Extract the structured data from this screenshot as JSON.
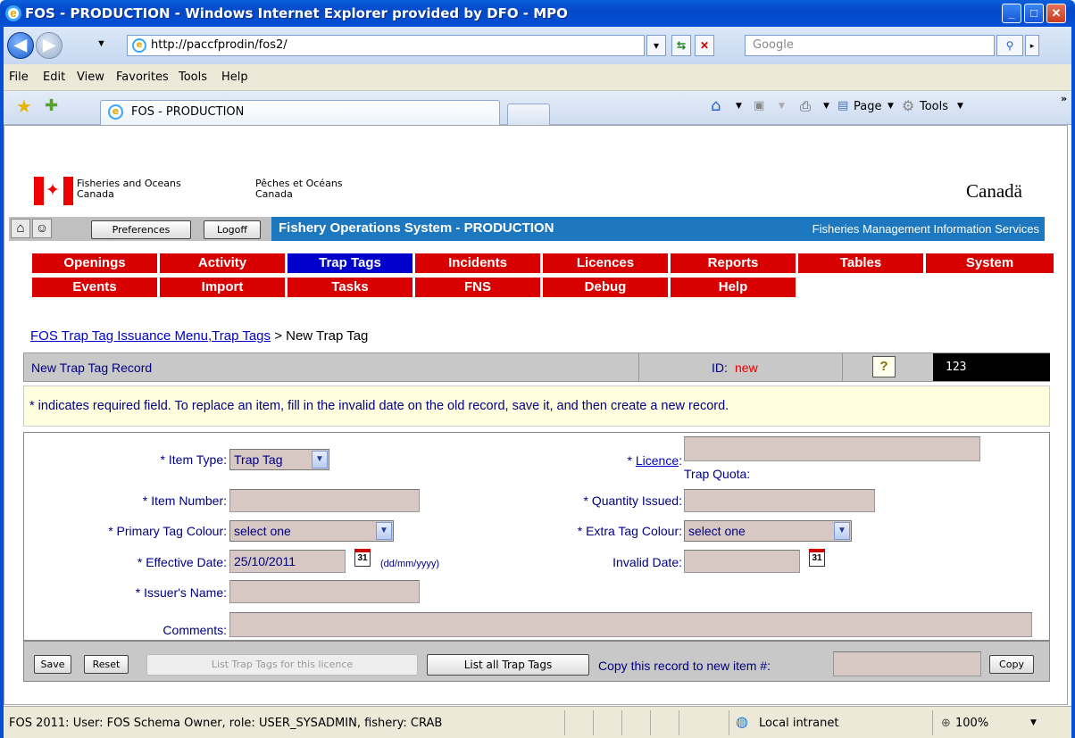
{
  "window": {
    "title": "FOS - PRODUCTION - Windows Internet Explorer provided by DFO - MPO"
  },
  "browser": {
    "address": "http://paccfprodin/fos2/",
    "search_placeholder": "Google",
    "menu": [
      "File",
      "Edit",
      "View",
      "Favorites",
      "Tools",
      "Help"
    ],
    "tab_title": "FOS - PRODUCTION",
    "toolbar": {
      "page": "Page",
      "tools": "Tools"
    }
  },
  "banner": {
    "dept_en_1": "Fisheries and Oceans",
    "dept_en_2": "Canada",
    "dept_fr_1": "Pêches et Océans",
    "dept_fr_2": "Canada",
    "wordmark": "Canadä"
  },
  "header": {
    "preferences": "Preferences",
    "logoff": "Logoff",
    "system_title": "Fishery Operations System - PRODUCTION",
    "subtitle": "Fisheries Management Information Services"
  },
  "menu_rows": [
    [
      "Openings",
      "Activity",
      "Trap Tags",
      "Incidents",
      "Licences",
      "Reports",
      "Tables",
      "System"
    ],
    [
      "Events",
      "Import",
      "Tasks",
      "FNS",
      "Debug",
      "Help"
    ]
  ],
  "active_menu": "Trap Tags",
  "breadcrumb": {
    "link": "FOS Trap Tag Issuance Menu,Trap Tags",
    "current": " > New Trap Tag"
  },
  "record": {
    "title": "New Trap Tag Record",
    "id_label": "ID:",
    "id_value": "new",
    "help": "?",
    "counter": "123"
  },
  "info": "* indicates required field. To replace an item, fill in the invalid date on the old record, save it, and then create a new record.",
  "form": {
    "item_type_label": "* Item Type:",
    "item_type_value": "Trap Tag",
    "item_number_label": "* Item Number:",
    "primary_colour_label": "* Primary Tag Colour:",
    "primary_colour_value": "select one",
    "effective_date_label": "* Effective Date:",
    "effective_date_value": "25/10/2011",
    "date_format": "(dd/mm/yyyy)",
    "issuer_label": "* Issuer's Name:",
    "comments_label": "Comments:",
    "licence_prefix": "* ",
    "licence_label": "Licence",
    "licence_suffix": ":",
    "trap_quota_label": "Trap Quota:",
    "quantity_label": "* Quantity Issued:",
    "extra_colour_label": "* Extra Tag Colour:",
    "extra_colour_value": "select one",
    "invalid_date_label": "Invalid Date:",
    "calendar_glyph": "31"
  },
  "footer": {
    "save": "Save",
    "reset": "Reset",
    "list_licence": "List Trap Tags for this licence",
    "list_all": "List all Trap Tags",
    "copy_label": "Copy this record to new item #:",
    "copy": "Copy"
  },
  "status": {
    "text": "FOS 2011: User: FOS Schema Owner, role: USER_SYSADMIN, fishery: CRAB",
    "zone": "Local intranet",
    "zoom": "100%"
  },
  "colors": {
    "menu_red": "#d80000",
    "menu_active": "#0000cc",
    "header_blue": "#1e78c0",
    "input_bg": "#d7c8c4",
    "label_blue": "#000080"
  }
}
